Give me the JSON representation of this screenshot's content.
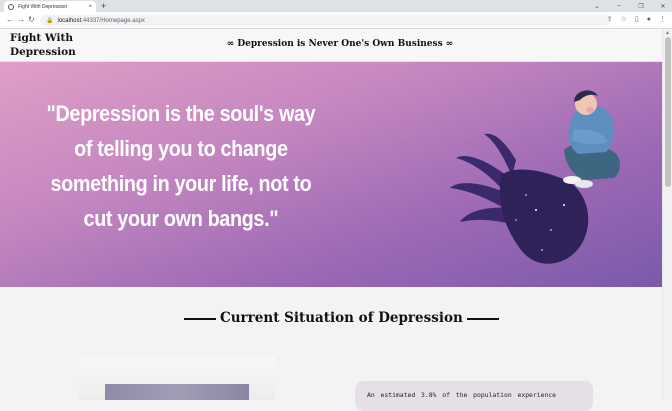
{
  "browser": {
    "tab_title": "Fight With Depression",
    "tab_close": "×",
    "new_tab": "+",
    "url_host": "localhost",
    "url_rest": ":44337/Homepage.aspx",
    "window_controls": [
      "⌄",
      "–",
      "❐",
      "✕"
    ]
  },
  "header": {
    "logo": "Fight With Depression",
    "tagline": "∞ Depression is Never One's Own Business ∞"
  },
  "hero": {
    "quote": "\"Depression is the soul's way of telling you to change something in your life, not to cut your own bangs.\""
  },
  "section": {
    "title": "Current Situation of Depression",
    "info_text": "An estimated 3.8% of the population experience"
  },
  "colors": {
    "hero_top": "#df9fc6",
    "hero_bottom": "#7a5aaa",
    "card_bg": "#e6dfe6"
  }
}
